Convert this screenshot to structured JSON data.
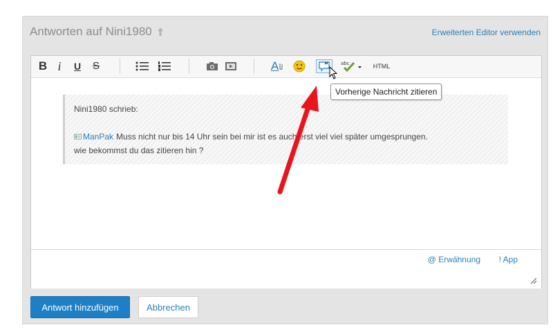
{
  "header": {
    "title": "Antworten auf Nini1980",
    "advanced_editor": "Erweiterten Editor verwenden"
  },
  "toolbar": {
    "bold": "B",
    "italic": "i",
    "underline": "U",
    "strike": "S",
    "font_color": "A",
    "spellcheck_label": "abc",
    "html": "HTML",
    "tooltip": "Vorherige Nachricht zitieren"
  },
  "quote": {
    "author_line": "Nini1980 schrieb:",
    "mentioned_user": "ManPak",
    "line1": "Muss nicht nur bis 14 Uhr sein bei mir ist es auch erst viel viel später umgesprungen.",
    "line2": "wie bekommst du das zitieren hin ?"
  },
  "footer": {
    "mention": "@ Erwähnung",
    "app": "! App"
  },
  "actions": {
    "submit": "Antwort hinzufügen",
    "cancel": "Abbrechen"
  },
  "colors": {
    "accent": "#1e7fc6",
    "link": "#2a7fb8",
    "annotation_arrow": "#e8161b"
  }
}
